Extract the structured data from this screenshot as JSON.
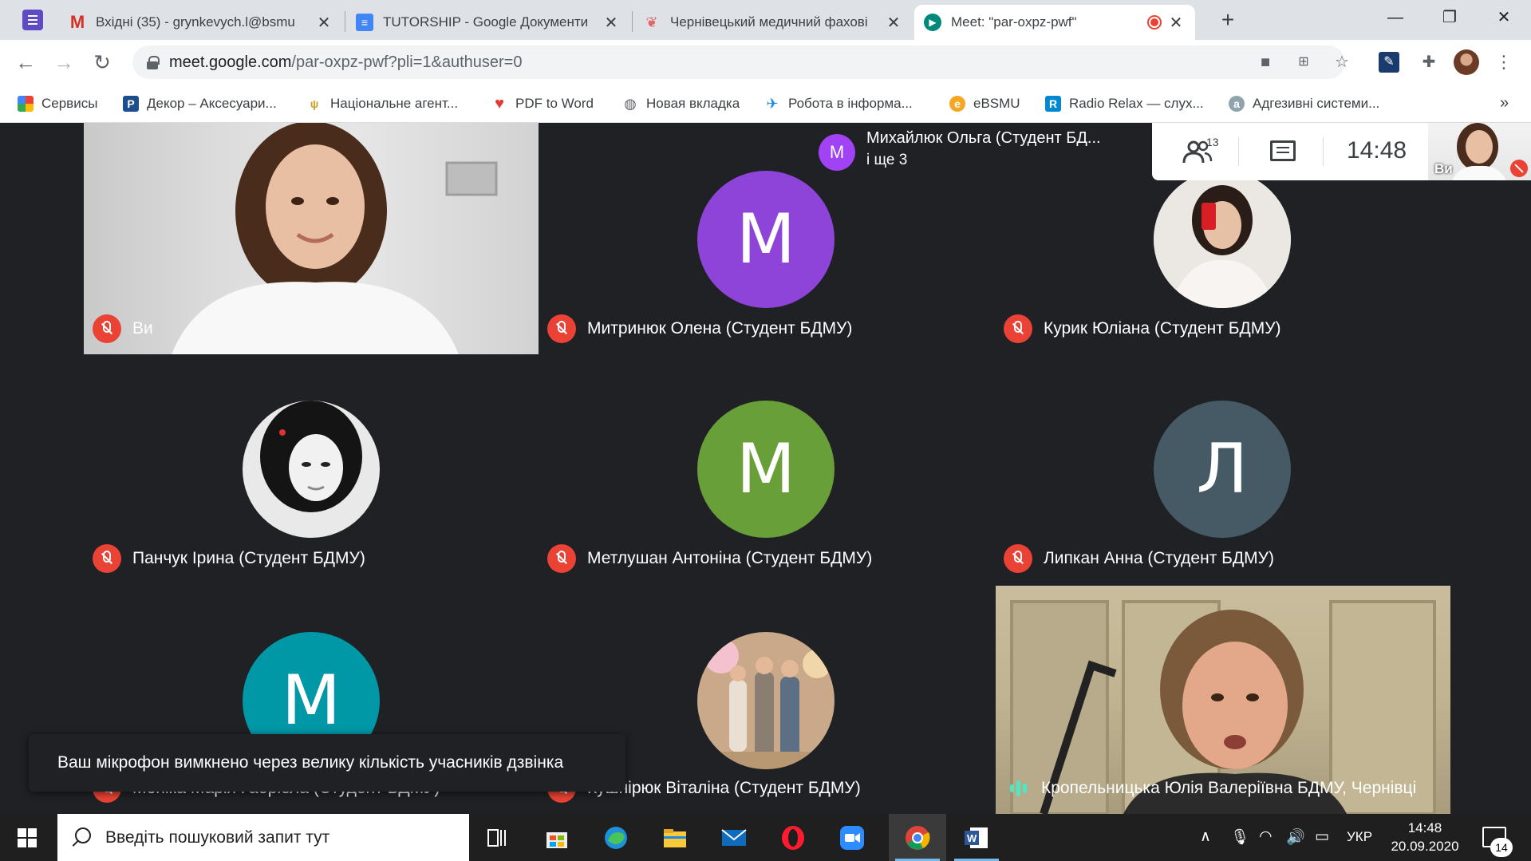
{
  "tabs": [
    {
      "title": "Вхідні (35) - grynkevych.l@bsmu",
      "icon": "gmail-icon"
    },
    {
      "title": "TUTORSHIP - Google Документи",
      "icon": "docs-icon"
    },
    {
      "title": "Чернівецький медичний фахові",
      "icon": "college-icon"
    },
    {
      "title": "Meet: \"par-oxpz-pwf\"",
      "icon": "meet-icon"
    }
  ],
  "url": {
    "host": "meet.google.com",
    "path": "/par-oxpz-pwf?pli=1&authuser=0"
  },
  "bookmarks": [
    "Сервисы",
    "Декор – Аксесуари...",
    "Національне агент...",
    "PDF to Word",
    "Новая вкладка",
    "Робота в інформа...",
    "eBSMU",
    "Radio Relax — слух...",
    "Адгезивні системи..."
  ],
  "meet": {
    "presenter_name": "Михайлюк Ольга (Студент БД...",
    "presenter_more": "і ще 3",
    "presenter_initial": "M",
    "participants_count": "13",
    "time": "14:48",
    "self_label": "Ви",
    "tiles": [
      {
        "name": "Ви"
      },
      {
        "name": "Митринюк Олена (Студент БДМУ)",
        "initial": "M"
      },
      {
        "name": "Курик Юліана (Студент БДМУ)"
      },
      {
        "name": "Панчук Ірина (Студент БДМУ)"
      },
      {
        "name": "Метлушан Антоніна (Студент БДМУ)",
        "initial": "M"
      },
      {
        "name": "Липкан Анна (Студент БДМУ)",
        "initial": "Л"
      },
      {
        "name": "Моніка Марія Габріела (Студент БДМУ)",
        "initial": "M"
      },
      {
        "name": "Кушнірюк Віталіна (Студент БДМУ)"
      },
      {
        "name": "Кропельницька Юлія Валеріївна БДМУ, Чернівці"
      }
    ],
    "toast": "Ваш мікрофон вимкнено через велику кількість учасників дзвінка"
  },
  "colors": {
    "avatar_purple": "#8e44d8",
    "avatar_green": "#689f38",
    "avatar_slate": "#455a64",
    "avatar_teal": "#0097a7",
    "mic_off_red": "#ea4335"
  },
  "taskbar": {
    "search_placeholder": "Введіть пошуковий запит тут",
    "language": "УКР",
    "time": "14:48",
    "date": "20.09.2020",
    "notifications": "14"
  }
}
